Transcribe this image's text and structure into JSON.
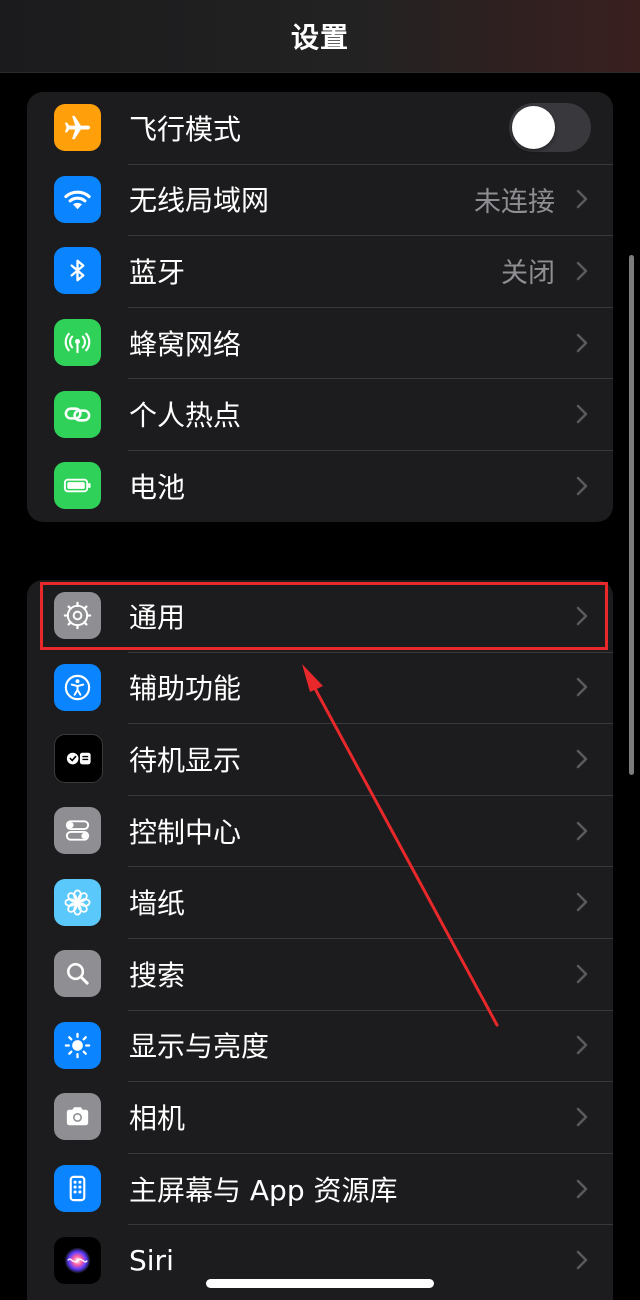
{
  "nav": {
    "title": "设置"
  },
  "group1": {
    "items": [
      {
        "label": "飞行模式",
        "icon": "airplane-icon",
        "color": "#ff9f0a",
        "toggle": false
      },
      {
        "label": "无线局域网",
        "icon": "wifi-icon",
        "color": "#0a84ff",
        "value": "未连接"
      },
      {
        "label": "蓝牙",
        "icon": "bluetooth-icon",
        "color": "#0a84ff",
        "value": "关闭"
      },
      {
        "label": "蜂窝网络",
        "icon": "cellular-antenna-icon",
        "color": "#30d158"
      },
      {
        "label": "个人热点",
        "icon": "hotspot-link-icon",
        "color": "#30d158"
      },
      {
        "label": "电池",
        "icon": "battery-icon",
        "color": "#30d158"
      }
    ]
  },
  "group2": {
    "items": [
      {
        "label": "通用",
        "icon": "gear-icon",
        "color": "#8e8e93",
        "highlighted": true
      },
      {
        "label": "辅助功能",
        "icon": "accessibility-icon",
        "color": "#0a84ff"
      },
      {
        "label": "待机显示",
        "icon": "standby-icon",
        "color": "#000000"
      },
      {
        "label": "控制中心",
        "icon": "control-center-icon",
        "color": "#8e8e93"
      },
      {
        "label": "墙纸",
        "icon": "flower-icon",
        "color": "#5ac8fa"
      },
      {
        "label": "搜索",
        "icon": "magnifier-icon",
        "color": "#8e8e93"
      },
      {
        "label": "显示与亮度",
        "icon": "sun-icon",
        "color": "#0a84ff"
      },
      {
        "label": "相机",
        "icon": "camera-icon",
        "color": "#8e8e93"
      },
      {
        "label": "主屏幕与 App 资源库",
        "icon": "home-screen-icon",
        "color": "#0a84ff"
      },
      {
        "label": "Siri",
        "icon": "siri-icon",
        "color": "#1c1c1e"
      }
    ]
  },
  "annotation": {
    "color": "#e8282a"
  }
}
